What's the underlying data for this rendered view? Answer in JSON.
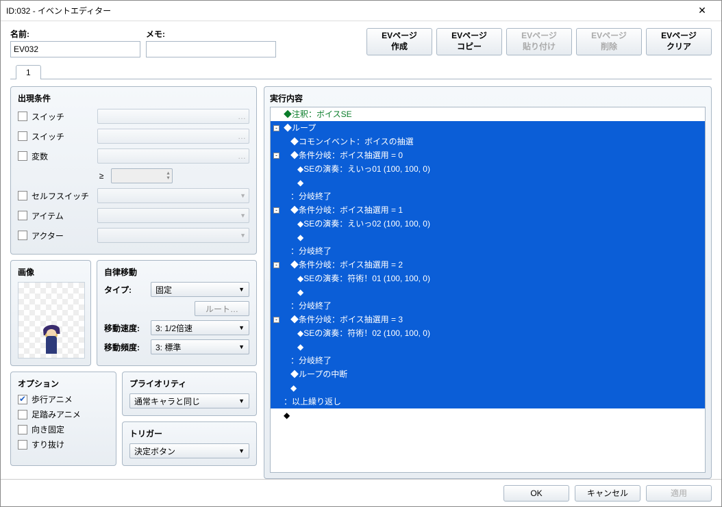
{
  "window_title": "ID:032 - イベントエディター",
  "name_label": "名前:",
  "name_value": "EV032",
  "memo_label": "メモ:",
  "memo_value": "",
  "ev_buttons": [
    {
      "l1": "EVページ",
      "l2": "作成",
      "disabled": false
    },
    {
      "l1": "EVページ",
      "l2": "コピー",
      "disabled": false
    },
    {
      "l1": "EVページ",
      "l2": "貼り付け",
      "disabled": true
    },
    {
      "l1": "EVページ",
      "l2": "削除",
      "disabled": true
    },
    {
      "l1": "EVページ",
      "l2": "クリア",
      "disabled": false
    }
  ],
  "tab_label": "1",
  "cond_title": "出現条件",
  "cond_items": [
    {
      "label": "スイッチ",
      "type": "combo",
      "trail": "…"
    },
    {
      "label": "スイッチ",
      "type": "combo",
      "trail": "…"
    },
    {
      "label": "変数",
      "type": "combo",
      "trail": "…"
    },
    {
      "label": "",
      "type": "ge_spin"
    },
    {
      "label": "セルフスイッチ",
      "type": "select"
    },
    {
      "label": "アイテム",
      "type": "select"
    },
    {
      "label": "アクター",
      "type": "select"
    }
  ],
  "ge_symbol": "≥",
  "image_title": "画像",
  "move_title": "自律移動",
  "move_type_label": "タイプ:",
  "move_type_value": "固定",
  "route_btn": "ルート…",
  "move_speed_label": "移動速度:",
  "move_speed_value": "3: 1/2倍速",
  "move_freq_label": "移動頻度:",
  "move_freq_value": "3: 標準",
  "opt_title": "オプション",
  "opt_items": [
    {
      "label": "歩行アニメ",
      "checked": true
    },
    {
      "label": "足踏みアニメ",
      "checked": false
    },
    {
      "label": "向き固定",
      "checked": false
    },
    {
      "label": "すり抜け",
      "checked": false
    }
  ],
  "priority_title": "プライオリティ",
  "priority_value": "通常キャラと同じ",
  "trigger_title": "トリガー",
  "trigger_value": "決定ボタン",
  "exec_title": "実行内容",
  "commands": [
    {
      "sel": false,
      "toggle": "",
      "indent": 0,
      "text": "◆注釈：ボイスSE",
      "cls": "green"
    },
    {
      "sel": true,
      "toggle": "-",
      "indent": 0,
      "text": "◆ループ"
    },
    {
      "sel": true,
      "toggle": "",
      "indent": 1,
      "text": "◆コモンイベント：ボイスの抽選"
    },
    {
      "sel": true,
      "toggle": "-",
      "indent": 1,
      "text": "◆条件分岐：ボイス抽選用 = 0"
    },
    {
      "sel": true,
      "toggle": "",
      "indent": 2,
      "text": "◆SEの演奏：えいっ01 (100, 100, 0)"
    },
    {
      "sel": true,
      "toggle": "",
      "indent": 2,
      "text": "◆"
    },
    {
      "sel": true,
      "toggle": "",
      "indent": 1,
      "text": "：分岐終了"
    },
    {
      "sel": true,
      "toggle": "-",
      "indent": 1,
      "text": "◆条件分岐：ボイス抽選用 = 1"
    },
    {
      "sel": true,
      "toggle": "",
      "indent": 2,
      "text": "◆SEの演奏：えいっ02 (100, 100, 0)"
    },
    {
      "sel": true,
      "toggle": "",
      "indent": 2,
      "text": "◆"
    },
    {
      "sel": true,
      "toggle": "",
      "indent": 1,
      "text": "：分岐終了"
    },
    {
      "sel": true,
      "toggle": "-",
      "indent": 1,
      "text": "◆条件分岐：ボイス抽選用 = 2"
    },
    {
      "sel": true,
      "toggle": "",
      "indent": 2,
      "text": "◆SEの演奏：符術！01 (100, 100, 0)"
    },
    {
      "sel": true,
      "toggle": "",
      "indent": 2,
      "text": "◆"
    },
    {
      "sel": true,
      "toggle": "",
      "indent": 1,
      "text": "：分岐終了"
    },
    {
      "sel": true,
      "toggle": "-",
      "indent": 1,
      "text": "◆条件分岐：ボイス抽選用 = 3"
    },
    {
      "sel": true,
      "toggle": "",
      "indent": 2,
      "text": "◆SEの演奏：符術！02 (100, 100, 0)"
    },
    {
      "sel": true,
      "toggle": "",
      "indent": 2,
      "text": "◆"
    },
    {
      "sel": true,
      "toggle": "",
      "indent": 1,
      "text": "：分岐終了"
    },
    {
      "sel": true,
      "toggle": "",
      "indent": 1,
      "text": "◆ループの中断"
    },
    {
      "sel": true,
      "toggle": "",
      "indent": 1,
      "text": "◆"
    },
    {
      "sel": true,
      "toggle": "",
      "indent": 0,
      "text": "：以上繰り返し"
    },
    {
      "sel": false,
      "toggle": "",
      "indent": 0,
      "text": "◆"
    }
  ],
  "ok_btn": "OK",
  "cancel_btn": "キャンセル",
  "apply_btn": "適用"
}
